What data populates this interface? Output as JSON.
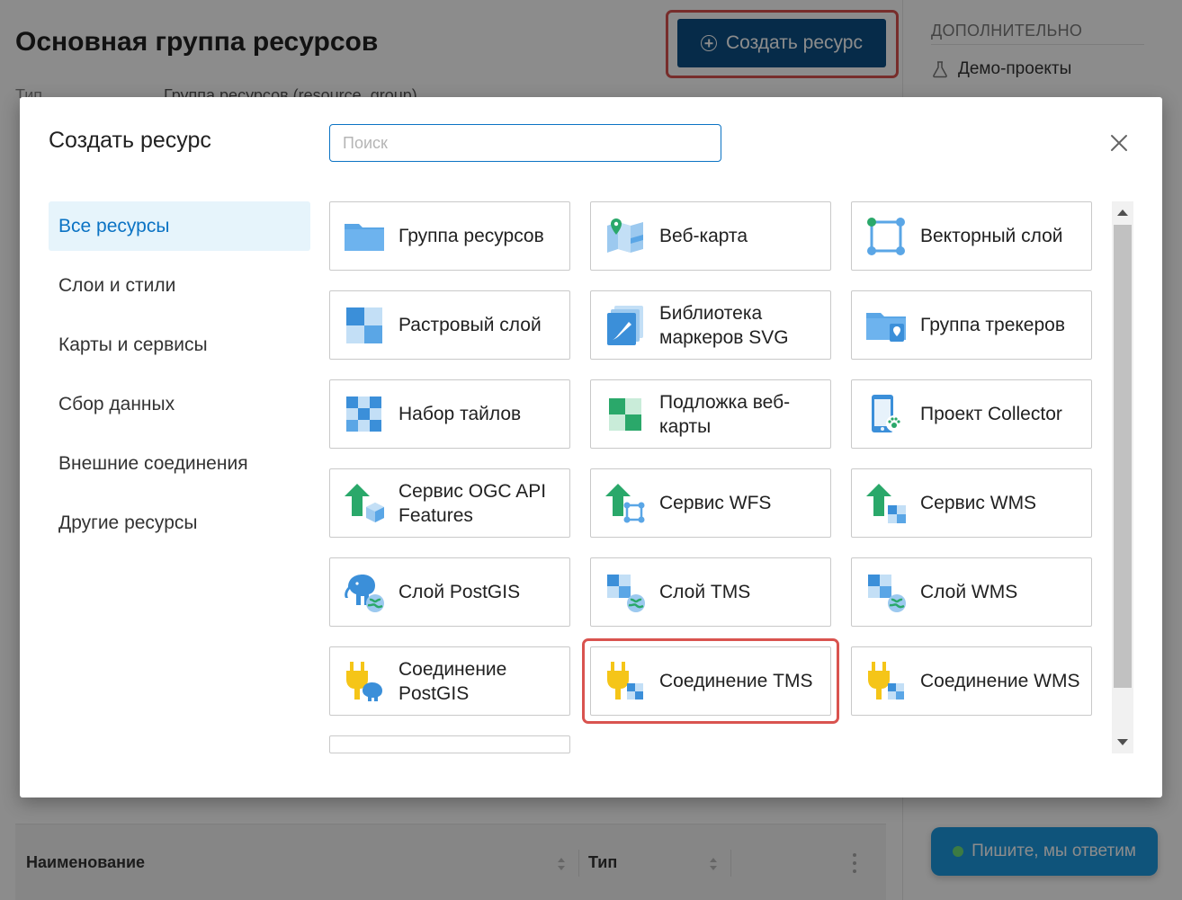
{
  "page": {
    "title": "Основная группа ресурсов",
    "create_button_label": "Создать ресурс",
    "meta_label": "Тип",
    "meta_value": "Группа ресурсов (resource_group)",
    "sidebar_heading": "ДОПОЛНИТЕЛЬНО",
    "sidebar_link": "Демо-проекты",
    "table": {
      "col_name": "Наименование",
      "col_type": "Тип"
    },
    "chat_label": "Пишите, мы ответим"
  },
  "modal": {
    "title": "Создать ресурс",
    "search_placeholder": "Поиск",
    "search_value": "",
    "categories": [
      {
        "label": "Все ресурсы",
        "active": true
      },
      {
        "label": "Слои и стили"
      },
      {
        "label": "Карты и сервисы"
      },
      {
        "label": "Сбор данных"
      },
      {
        "label": "Внешние соединения"
      },
      {
        "label": "Другие ресурсы"
      }
    ],
    "resources": [
      {
        "label": "Группа ресурсов",
        "icon": "folder-icon"
      },
      {
        "label": "Веб-карта",
        "icon": "webmap-icon"
      },
      {
        "label": "Векторный слой",
        "icon": "vector-layer-icon"
      },
      {
        "label": "Растровый слой",
        "icon": "raster-layer-icon"
      },
      {
        "label": "Библиотека маркеров SVG",
        "icon": "svg-marker-library-icon"
      },
      {
        "label": "Группа трекеров",
        "icon": "tracker-group-icon"
      },
      {
        "label": "Набор тайлов",
        "icon": "tileset-icon"
      },
      {
        "label": "Подложка веб-карты",
        "icon": "basemap-icon"
      },
      {
        "label": "Проект Collector",
        "icon": "collector-project-icon"
      },
      {
        "label": "Сервис OGC API Features",
        "icon": "ogcf-service-icon"
      },
      {
        "label": "Сервис WFS",
        "icon": "wfs-service-icon"
      },
      {
        "label": "Сервис WMS",
        "icon": "wms-service-icon"
      },
      {
        "label": "Слой PostGIS",
        "icon": "postgis-layer-icon"
      },
      {
        "label": "Слой TMS",
        "icon": "tms-layer-icon"
      },
      {
        "label": "Слой WMS",
        "icon": "wms-layer-icon"
      },
      {
        "label": "Соединение PostGIS",
        "icon": "postgis-connection-icon"
      },
      {
        "label": "Соединение TMS",
        "icon": "tms-connection-icon",
        "highlighted": true
      },
      {
        "label": "Соединение WMS",
        "icon": "wms-connection-icon"
      }
    ]
  },
  "colors": {
    "primary": "#0b4f86",
    "accent_blue": "#0b73c4",
    "highlight_red": "#d9534f",
    "chat_blue": "#1d9ae0"
  }
}
